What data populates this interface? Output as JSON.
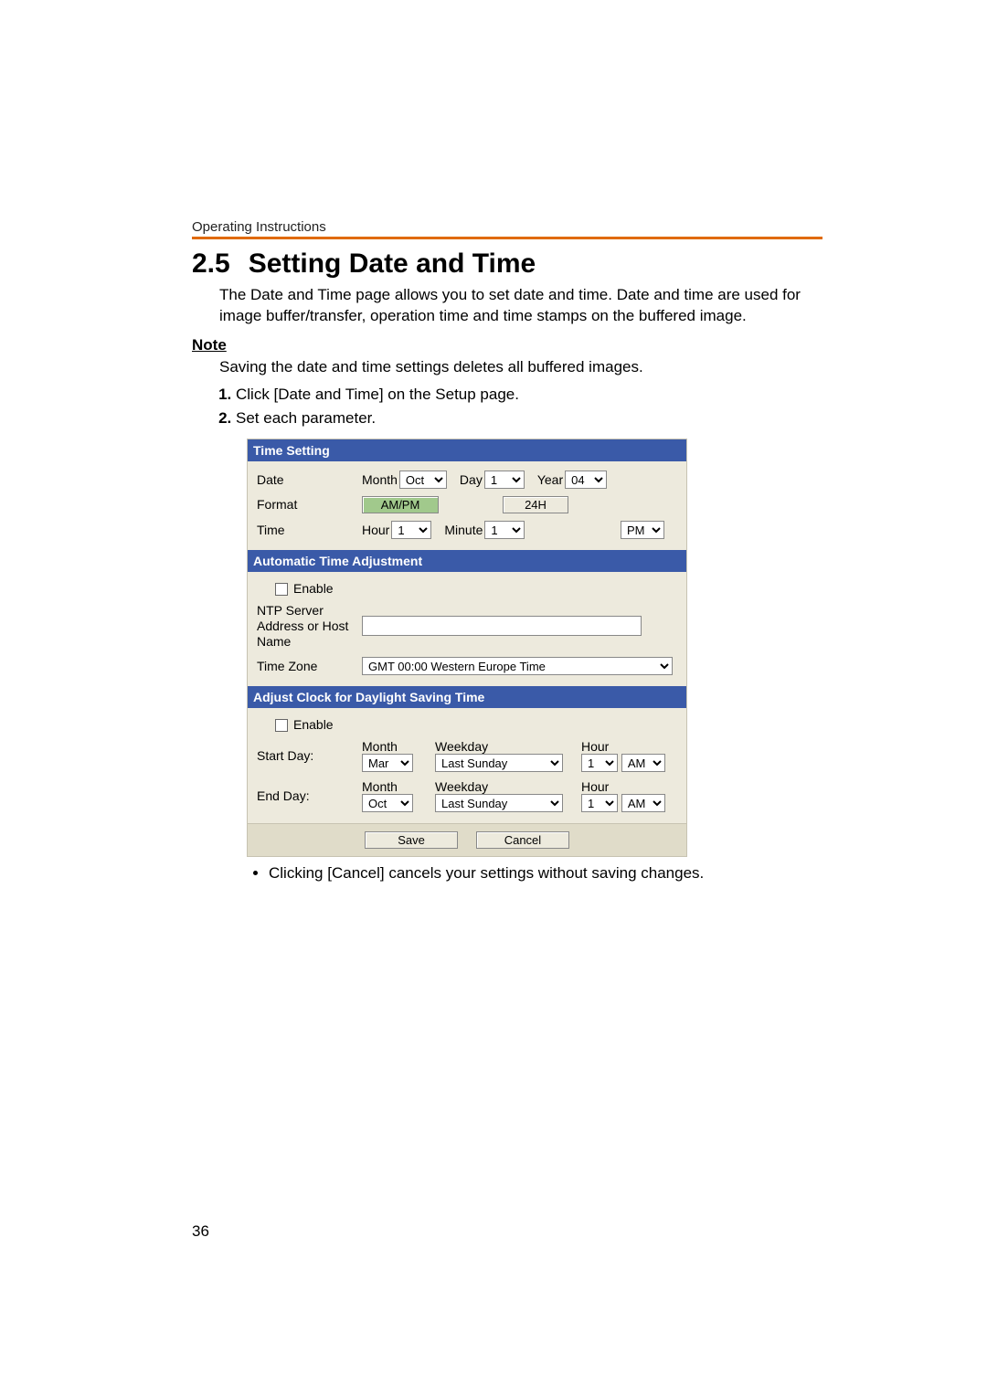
{
  "header": {
    "running": "Operating Instructions"
  },
  "title": {
    "number": "2.5",
    "text": "Setting Date and Time"
  },
  "intro": "The Date and Time page allows you to set date and time. Date and time are used for image buffer/transfer, operation time and time stamps on the buffered image.",
  "note": {
    "label": "Note",
    "text": "Saving the date and time settings deletes all buffered images."
  },
  "steps": [
    "Click [Date and Time] on the Setup page.",
    "Set each parameter."
  ],
  "dialog": {
    "section_time": "Time Setting",
    "date_label": "Date",
    "month_label": "Month",
    "month_value": "Oct",
    "day_label": "Day",
    "day_value": "1",
    "year_label": "Year",
    "year_value": "04",
    "format_label": "Format",
    "ampm_btn": "AM/PM",
    "h24_btn": "24H",
    "time_label": "Time",
    "hour_label": "Hour",
    "hour_value": "1",
    "minute_label": "Minute",
    "minute_value": "1",
    "ampm_value": "PM",
    "section_auto": "Automatic Time Adjustment",
    "enable_label": "Enable",
    "ntp_label": "NTP Server Address or Host Name",
    "ntp_value": "",
    "tz_label": "Time Zone",
    "tz_value": "GMT 00:00 Western Europe Time",
    "section_dst": "Adjust Clock for Daylight Saving Time",
    "start_label": "Start Day:",
    "end_label": "End Day:",
    "col_month": "Month",
    "col_weekday": "Weekday",
    "col_hour": "Hour",
    "start_month": "Mar",
    "start_weekday": "Last Sunday",
    "start_hour": "1",
    "start_ampm": "AM",
    "end_month": "Oct",
    "end_weekday": "Last Sunday",
    "end_hour": "1",
    "end_ampm": "AM",
    "save_btn": "Save",
    "cancel_btn": "Cancel"
  },
  "post_bullet": "Clicking [Cancel] cancels your settings without saving changes.",
  "page_number": "36"
}
